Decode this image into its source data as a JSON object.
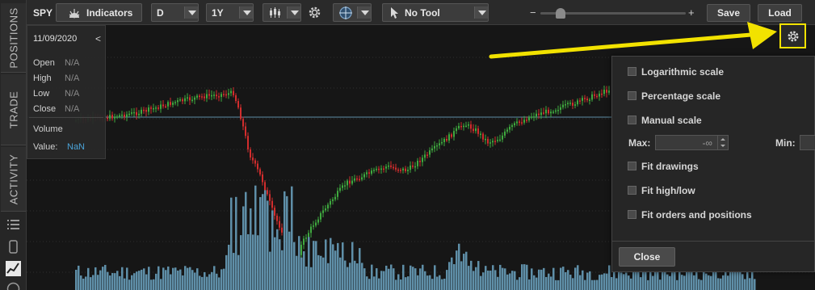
{
  "nav": {
    "tabs": [
      "POSITIONS",
      "TRADE",
      "ACTIVITY"
    ]
  },
  "toolbar": {
    "symbol": "SPY",
    "indicators_label": "Indicators",
    "period": "D",
    "range": "1Y",
    "tool": "No Tool",
    "zoom_minus": "−",
    "zoom_plus": "+",
    "zoom_level": 0.1,
    "save_label": "Save",
    "load_label": "Load"
  },
  "info": {
    "date": "11/09/2020",
    "collapse": "<",
    "rows": [
      {
        "label": "Open",
        "value": "N/A"
      },
      {
        "label": "High",
        "value": "N/A"
      },
      {
        "label": "Low",
        "value": "N/A"
      },
      {
        "label": "Close",
        "value": "N/A"
      }
    ],
    "volume_label": "Volume",
    "value_label": "Value:",
    "value": "NaN"
  },
  "settings": {
    "options": [
      {
        "label": "Logarithmic scale",
        "checked": false
      },
      {
        "label": "Percentage scale",
        "checked": false
      },
      {
        "label": "Manual scale",
        "checked": false
      },
      {
        "label": "Fit drawings",
        "checked": false
      },
      {
        "label": "Fit high/low",
        "checked": false
      },
      {
        "label": "Fit orders and positions",
        "checked": false
      }
    ],
    "max_label": "Max:",
    "max_value": "-∞",
    "min_label": "Min:",
    "close_label": "Close"
  },
  "colors": {
    "up": "#3fa93f",
    "down": "#d22d2d",
    "volume": "#5f8fa8",
    "annotation_arrow": "#f2e200",
    "price_line": "#5f8ea5"
  }
}
